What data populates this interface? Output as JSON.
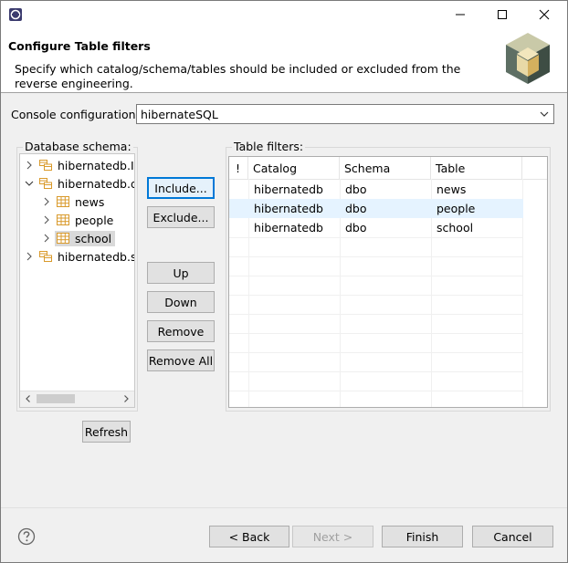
{
  "header": {
    "title": "Configure Table filters",
    "description": "Specify which catalog/schema/tables should be included or excluded from the reverse engineering."
  },
  "console": {
    "label": "Console configuration:",
    "value": "hibernateSQL"
  },
  "schema": {
    "label": "Database schema:",
    "tree": [
      {
        "label": "hibernatedb.IN",
        "level": 0,
        "expanded": false
      },
      {
        "label": "hibernatedb.d",
        "level": 0,
        "expanded": true
      },
      {
        "label": "news",
        "level": 1,
        "expanded": false
      },
      {
        "label": "people",
        "level": 1,
        "expanded": false
      },
      {
        "label": "school",
        "level": 1,
        "expanded": false,
        "selected": true
      },
      {
        "label": "hibernatedb.sy",
        "level": 0,
        "expanded": false
      }
    ]
  },
  "buttons": {
    "include": "Include...",
    "exclude": "Exclude...",
    "up": "Up",
    "down": "Down",
    "remove": "Remove",
    "remove_all": "Remove All",
    "refresh": "Refresh"
  },
  "filters": {
    "label": "Table filters:",
    "columns": [
      "!",
      "Catalog",
      "Schema",
      "Table"
    ],
    "rows": [
      {
        "catalog": "hibernatedb",
        "schema": "dbo",
        "table": "news"
      },
      {
        "catalog": "hibernatedb",
        "schema": "dbo",
        "table": "people"
      },
      {
        "catalog": "hibernatedb",
        "schema": "dbo",
        "table": "school"
      }
    ]
  },
  "footer": {
    "back": "< Back",
    "next": "Next >",
    "finish": "Finish",
    "cancel": "Cancel"
  },
  "colors": {
    "accent": "#0078d7",
    "selection": "#e5f3ff",
    "table_icon": "#d99a2b"
  }
}
